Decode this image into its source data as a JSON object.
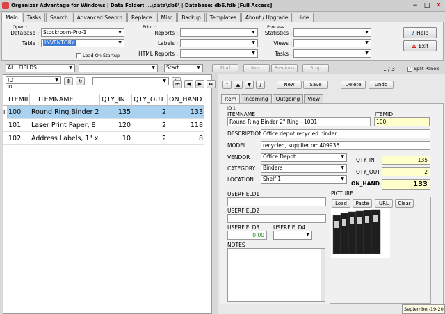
{
  "window": {
    "title": "Organizer Advantage for Windows | Data Folder: ...\\data\\db6\\ | Database: db6.fdb [Full Access]",
    "minimize": "−",
    "maximize": "□",
    "close": "✕"
  },
  "tabs": [
    "Main",
    "Tasks",
    "Search",
    "Advanced Search",
    "Replace",
    "Misc",
    "Backup",
    "Templates",
    "About / Upgrade",
    "Hide"
  ],
  "open_group": {
    "title": "Open :",
    "database_label": "Database :",
    "database_value": "Stockroom-Pro-1",
    "table_label": "Table :",
    "table_value": "INVENTORY",
    "load_on_startup": "Load On Startup"
  },
  "print_group": {
    "title": "Print :",
    "reports_label": "Reports :",
    "labels_label": "Labels :",
    "html_reports_label": "HTML Reports :"
  },
  "process_group": {
    "title": "Process :",
    "statistics_label": "Statistics :",
    "views_label": "Views :",
    "tasks_label": "Tasks :"
  },
  "help_button": "Help",
  "exit_button": "Exit",
  "search_bar": {
    "field_value": "ALL FIELDS",
    "mode_value": "Start",
    "find": "Find",
    "next": "Next",
    "previous": "Previous",
    "stop": "Stop",
    "record_count": "1 / 3",
    "split_panels": "Split Panels"
  },
  "sort_bar": {
    "field_value": "ID",
    "field_sub": "ID"
  },
  "grid": {
    "headers": [
      "ITEMID",
      "ITEMNAME",
      "QTY_IN",
      "QTY_OUT",
      "ON_HAND"
    ],
    "indicator": "I",
    "rows": [
      [
        "100",
        "Round Ring Binder 2",
        "135",
        "2",
        "133"
      ],
      [
        "101",
        "Laser Print Paper, 8",
        "120",
        "2",
        "118"
      ],
      [
        "102",
        "Address Labels, 1\" x",
        "10",
        "2",
        "8"
      ]
    ]
  },
  "record_buttons": {
    "new": "New",
    "save": "Save",
    "delete": "Delete",
    "undo": "Undo"
  },
  "record_tabs": [
    "Item",
    "Incoming",
    "Outgoing",
    "View"
  ],
  "form": {
    "id_label": "ID",
    "id_value": "1",
    "itemname_label": "ITEMNAME",
    "itemname_value": "Round Ring Binder 2\" Ring - 1001",
    "itemid_label": "ITEMID",
    "itemid_value": "100",
    "description_label": "DESCRIPTION",
    "description_value": "Office depot recycled binder",
    "model_label": "MODEL",
    "model_value": "recycled, supplier nr: 409936",
    "vendor_label": "VENDOR",
    "vendor_value": "Office Depot",
    "category_label": "CATEGORY",
    "category_value": "Binders",
    "location_label": "LOCATION",
    "location_value": "Shelf 1",
    "qty_in_label": "QTY_IN",
    "qty_in_value": "135",
    "qty_out_label": "QTY_OUT",
    "qty_out_value": "2",
    "on_hand_label": "ON_HAND",
    "on_hand_value": "133",
    "userfield1_label": "USERFIELD1",
    "userfield2_label": "USERFIELD2",
    "userfield3_label": "USERFIELD3",
    "userfield3_value": "0.00",
    "userfield4_label": "USERFIELD4",
    "notes_label": "NOTES",
    "picture_label": "PICTURE",
    "pic_load": "Load",
    "pic_paste": "Paste",
    "pic_url": "URL",
    "pic_clear": "Clear"
  },
  "status_date": "September-19-20"
}
